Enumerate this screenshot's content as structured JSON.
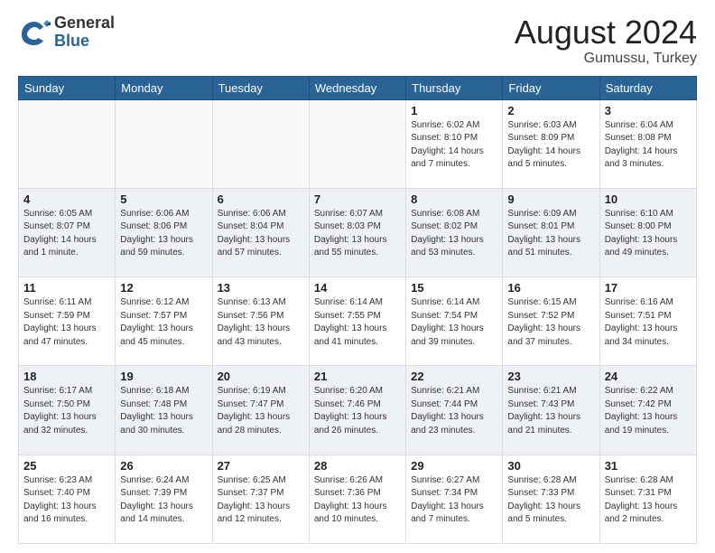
{
  "header": {
    "logo_general": "General",
    "logo_blue": "Blue",
    "month_year": "August 2024",
    "location": "Gumussu, Turkey"
  },
  "calendar": {
    "days_of_week": [
      "Sunday",
      "Monday",
      "Tuesday",
      "Wednesday",
      "Thursday",
      "Friday",
      "Saturday"
    ],
    "weeks": [
      [
        {
          "day": "",
          "info": ""
        },
        {
          "day": "",
          "info": ""
        },
        {
          "day": "",
          "info": ""
        },
        {
          "day": "",
          "info": ""
        },
        {
          "day": "1",
          "info": "Sunrise: 6:02 AM\nSunset: 8:10 PM\nDaylight: 14 hours\nand 7 minutes."
        },
        {
          "day": "2",
          "info": "Sunrise: 6:03 AM\nSunset: 8:09 PM\nDaylight: 14 hours\nand 5 minutes."
        },
        {
          "day": "3",
          "info": "Sunrise: 6:04 AM\nSunset: 8:08 PM\nDaylight: 14 hours\nand 3 minutes."
        }
      ],
      [
        {
          "day": "4",
          "info": "Sunrise: 6:05 AM\nSunset: 8:07 PM\nDaylight: 14 hours\nand 1 minute."
        },
        {
          "day": "5",
          "info": "Sunrise: 6:06 AM\nSunset: 8:06 PM\nDaylight: 13 hours\nand 59 minutes."
        },
        {
          "day": "6",
          "info": "Sunrise: 6:06 AM\nSunset: 8:04 PM\nDaylight: 13 hours\nand 57 minutes."
        },
        {
          "day": "7",
          "info": "Sunrise: 6:07 AM\nSunset: 8:03 PM\nDaylight: 13 hours\nand 55 minutes."
        },
        {
          "day": "8",
          "info": "Sunrise: 6:08 AM\nSunset: 8:02 PM\nDaylight: 13 hours\nand 53 minutes."
        },
        {
          "day": "9",
          "info": "Sunrise: 6:09 AM\nSunset: 8:01 PM\nDaylight: 13 hours\nand 51 minutes."
        },
        {
          "day": "10",
          "info": "Sunrise: 6:10 AM\nSunset: 8:00 PM\nDaylight: 13 hours\nand 49 minutes."
        }
      ],
      [
        {
          "day": "11",
          "info": "Sunrise: 6:11 AM\nSunset: 7:59 PM\nDaylight: 13 hours\nand 47 minutes."
        },
        {
          "day": "12",
          "info": "Sunrise: 6:12 AM\nSunset: 7:57 PM\nDaylight: 13 hours\nand 45 minutes."
        },
        {
          "day": "13",
          "info": "Sunrise: 6:13 AM\nSunset: 7:56 PM\nDaylight: 13 hours\nand 43 minutes."
        },
        {
          "day": "14",
          "info": "Sunrise: 6:14 AM\nSunset: 7:55 PM\nDaylight: 13 hours\nand 41 minutes."
        },
        {
          "day": "15",
          "info": "Sunrise: 6:14 AM\nSunset: 7:54 PM\nDaylight: 13 hours\nand 39 minutes."
        },
        {
          "day": "16",
          "info": "Sunrise: 6:15 AM\nSunset: 7:52 PM\nDaylight: 13 hours\nand 37 minutes."
        },
        {
          "day": "17",
          "info": "Sunrise: 6:16 AM\nSunset: 7:51 PM\nDaylight: 13 hours\nand 34 minutes."
        }
      ],
      [
        {
          "day": "18",
          "info": "Sunrise: 6:17 AM\nSunset: 7:50 PM\nDaylight: 13 hours\nand 32 minutes."
        },
        {
          "day": "19",
          "info": "Sunrise: 6:18 AM\nSunset: 7:48 PM\nDaylight: 13 hours\nand 30 minutes."
        },
        {
          "day": "20",
          "info": "Sunrise: 6:19 AM\nSunset: 7:47 PM\nDaylight: 13 hours\nand 28 minutes."
        },
        {
          "day": "21",
          "info": "Sunrise: 6:20 AM\nSunset: 7:46 PM\nDaylight: 13 hours\nand 26 minutes."
        },
        {
          "day": "22",
          "info": "Sunrise: 6:21 AM\nSunset: 7:44 PM\nDaylight: 13 hours\nand 23 minutes."
        },
        {
          "day": "23",
          "info": "Sunrise: 6:21 AM\nSunset: 7:43 PM\nDaylight: 13 hours\nand 21 minutes."
        },
        {
          "day": "24",
          "info": "Sunrise: 6:22 AM\nSunset: 7:42 PM\nDaylight: 13 hours\nand 19 minutes."
        }
      ],
      [
        {
          "day": "25",
          "info": "Sunrise: 6:23 AM\nSunset: 7:40 PM\nDaylight: 13 hours\nand 16 minutes."
        },
        {
          "day": "26",
          "info": "Sunrise: 6:24 AM\nSunset: 7:39 PM\nDaylight: 13 hours\nand 14 minutes."
        },
        {
          "day": "27",
          "info": "Sunrise: 6:25 AM\nSunset: 7:37 PM\nDaylight: 13 hours\nand 12 minutes."
        },
        {
          "day": "28",
          "info": "Sunrise: 6:26 AM\nSunset: 7:36 PM\nDaylight: 13 hours\nand 10 minutes."
        },
        {
          "day": "29",
          "info": "Sunrise: 6:27 AM\nSunset: 7:34 PM\nDaylight: 13 hours\nand 7 minutes."
        },
        {
          "day": "30",
          "info": "Sunrise: 6:28 AM\nSunset: 7:33 PM\nDaylight: 13 hours\nand 5 minutes."
        },
        {
          "day": "31",
          "info": "Sunrise: 6:28 AM\nSunset: 7:31 PM\nDaylight: 13 hours\nand 2 minutes."
        }
      ]
    ]
  }
}
